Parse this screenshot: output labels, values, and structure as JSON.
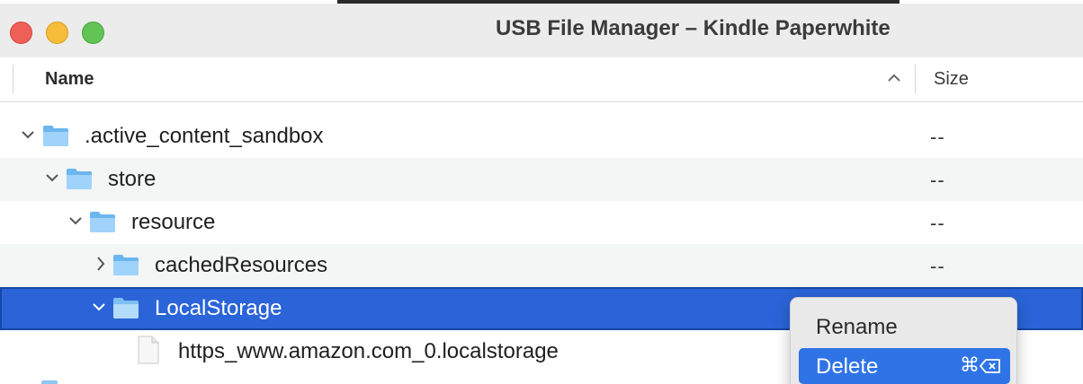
{
  "window": {
    "title": "USB File Manager – Kindle Paperwhite"
  },
  "columns": {
    "name": "Name",
    "size": "Size",
    "sort_icon": "chevron-up-icon"
  },
  "rows": [
    {
      "label": ".active_content_sandbox",
      "size": "--",
      "expanded": true,
      "kind": "folder",
      "depth": 0
    },
    {
      "label": "store",
      "size": "--",
      "expanded": true,
      "kind": "folder",
      "depth": 1
    },
    {
      "label": "resource",
      "size": "--",
      "expanded": true,
      "kind": "folder",
      "depth": 2
    },
    {
      "label": "cachedResources",
      "size": "--",
      "expanded": false,
      "kind": "folder",
      "depth": 3
    },
    {
      "label": "LocalStorage",
      "size": "",
      "expanded": true,
      "kind": "folder",
      "depth": 3,
      "selected": true
    },
    {
      "label": "https_www.amazon.com_0.localstorage",
      "size": "",
      "kind": "file",
      "depth": 4
    }
  ],
  "context_menu": {
    "rename": "Rename",
    "delete": "Delete",
    "delete_shortcut": "⌘"
  },
  "colors": {
    "selection": "#2a64d8",
    "menu_highlight": "#2f74e6",
    "folder": "#7cc0f2"
  }
}
